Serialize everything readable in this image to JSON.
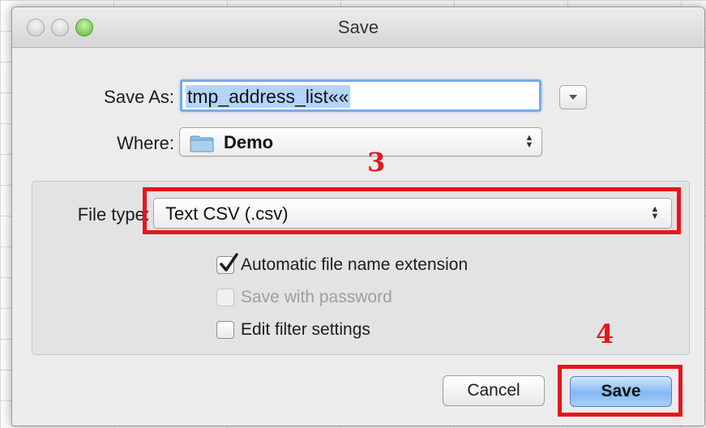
{
  "window": {
    "title": "Save"
  },
  "form": {
    "save_as_label": "Save As:",
    "save_as_value": "tmp_address_list««",
    "where_label": "Where:",
    "where_value": "Demo",
    "file_type_label": "File type:",
    "file_type_value": "Text CSV (.csv)"
  },
  "options": {
    "auto_extension": {
      "label": "Automatic file name extension",
      "checked": true
    },
    "password": {
      "label": "Save with password",
      "checked": false,
      "disabled": true
    },
    "filter_settings": {
      "label": "Edit filter settings",
      "checked": false
    }
  },
  "buttons": {
    "cancel": "Cancel",
    "save": "Save"
  },
  "annotations": {
    "step_3": "3",
    "step_4": "4"
  },
  "colors": {
    "annotation": "#e8141b",
    "focus": "#79a9e8",
    "default_button": "#83b9f3"
  }
}
